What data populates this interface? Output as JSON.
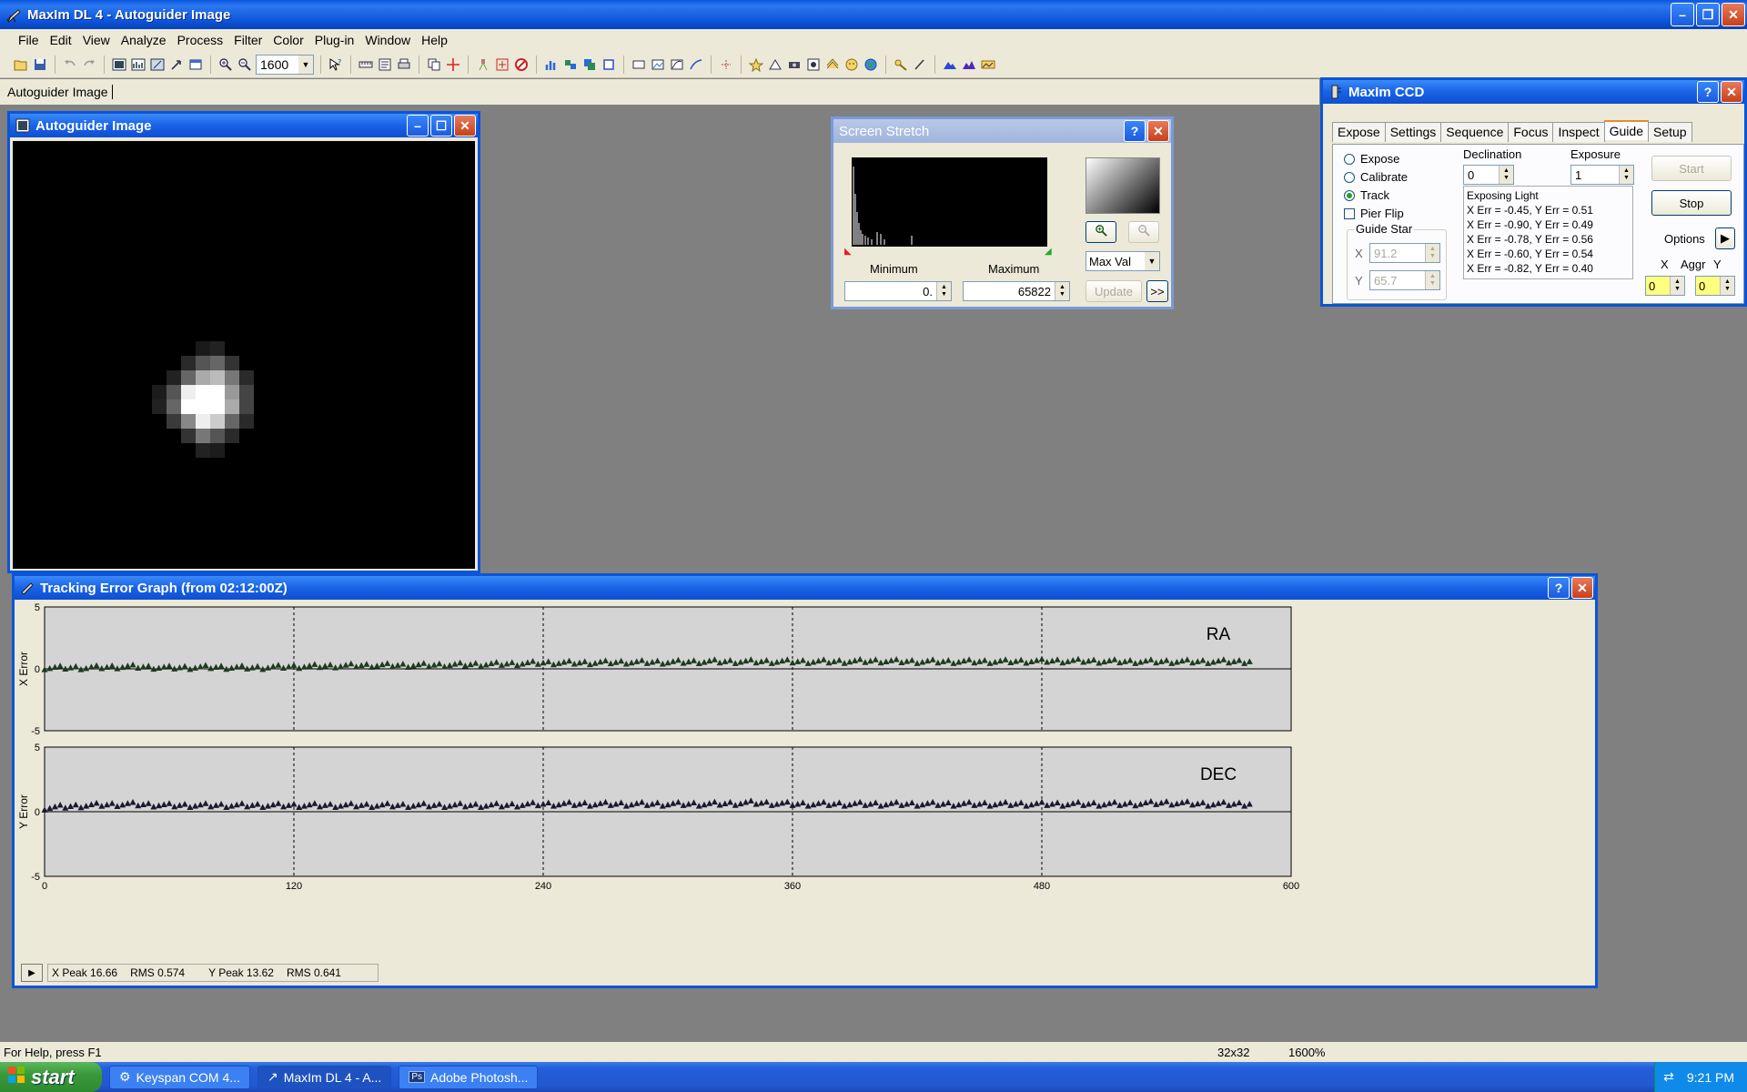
{
  "app": {
    "title": "MaxIm DL 4 - Autoguider Image"
  },
  "menu": [
    "File",
    "Edit",
    "View",
    "Analyze",
    "Process",
    "Filter",
    "Color",
    "Plug-in",
    "Window",
    "Help"
  ],
  "toolbar": {
    "zoom_value": "1600"
  },
  "doc_tab": "Autoguider Image",
  "autoguider": {
    "title": "Autoguider Image"
  },
  "stretch": {
    "title": "Screen Stretch",
    "min_label": "Minimum",
    "max_label": "Maximum",
    "min_value": "0.",
    "max_value": "65822",
    "mode": "Max Val",
    "update": "Update",
    "more": ">>"
  },
  "ccd": {
    "title": "MaxIm CCD",
    "tabs": [
      "Expose",
      "Settings",
      "Sequence",
      "Focus",
      "Inspect",
      "Guide",
      "Setup"
    ],
    "active_tab": "Guide",
    "modes": [
      "Expose",
      "Calibrate",
      "Track"
    ],
    "selected_mode": "Track",
    "pier_flip": "Pier Flip",
    "declination_label": "Declination",
    "declination_value": "0",
    "exposure_label": "Exposure",
    "exposure_value": "1",
    "guide_star_label": "Guide Star",
    "x_label": "X",
    "x_value": "91.2",
    "y_label": "Y",
    "y_value": "65.7",
    "status_lines": [
      "Exposing Light",
      "X Err = -0.45, Y Err = 0.51",
      "X Err = -0.90, Y Err = 0.49",
      "X Err = -0.78, Y Err = 0.56",
      "X Err = -0.60, Y Err = 0.54",
      "X Err = -0.82, Y Err = 0.40"
    ],
    "start": "Start",
    "stop": "Stop",
    "options": "Options",
    "aggr_x": "X",
    "aggr_label": "Aggr",
    "aggr_y": "Y",
    "aggr_x_value": "0",
    "aggr_y_value": "0"
  },
  "graph": {
    "title": "Tracking Error Graph (from 02:12:00Z)",
    "footer": {
      "xpeak": "X Peak 16.66",
      "xrms": "RMS 0.574",
      "ypeak": "Y Peak 13.62",
      "yrms": "RMS 0.641"
    }
  },
  "chart_data": [
    {
      "type": "scatter",
      "title": "RA",
      "ylabel": "X Error",
      "ylim": [
        -5,
        5
      ],
      "xlim": [
        0,
        600
      ],
      "yticks": [
        "5",
        "0",
        "-5"
      ],
      "grid": "dashed vertical every 120",
      "marker": "triangle",
      "color": "#1f3a1f",
      "x": [
        0,
        20,
        40,
        60,
        80,
        100,
        120,
        140,
        160,
        180,
        200,
        220,
        240,
        260,
        280,
        300,
        320,
        340,
        360,
        380,
        400,
        420,
        440,
        460,
        480,
        500,
        520,
        540,
        560,
        580
      ],
      "y": [
        0.1,
        0.1,
        0.2,
        0.1,
        0.15,
        0.1,
        0.2,
        0.25,
        0.3,
        0.3,
        0.35,
        0.4,
        0.5,
        0.5,
        0.55,
        0.55,
        0.6,
        0.6,
        0.6,
        0.6,
        0.65,
        0.6,
        0.6,
        0.6,
        0.65,
        0.65,
        0.6,
        0.6,
        0.6,
        0.6
      ]
    },
    {
      "type": "scatter",
      "title": "DEC",
      "ylabel": "Y Error",
      "ylim": [
        -5,
        5
      ],
      "xlim": [
        0,
        600
      ],
      "yticks": [
        "5",
        "0",
        "-5"
      ],
      "xticks": [
        "0",
        "120",
        "240",
        "360",
        "480",
        "600"
      ],
      "grid": "dashed vertical every 120",
      "marker": "triangle",
      "color": "#1a1a2e",
      "x": [
        0,
        20,
        40,
        60,
        80,
        100,
        120,
        140,
        160,
        180,
        200,
        220,
        240,
        260,
        280,
        300,
        320,
        340,
        360,
        380,
        400,
        420,
        440,
        460,
        480,
        500,
        520,
        540,
        560,
        580
      ],
      "y": [
        0.3,
        0.5,
        0.6,
        0.5,
        0.5,
        0.5,
        0.5,
        0.5,
        0.5,
        0.5,
        0.5,
        0.5,
        0.6,
        0.6,
        0.6,
        0.6,
        0.6,
        0.7,
        0.6,
        0.6,
        0.6,
        0.6,
        0.6,
        0.6,
        0.6,
        0.6,
        0.6,
        0.7,
        0.6,
        0.6
      ]
    }
  ],
  "statusbar": {
    "help": "For Help, press F1",
    "size": "32x32",
    "zoom": "1600%"
  },
  "taskbar": {
    "start": "start",
    "tasks": [
      "Keyspan COM 4...",
      "MaxIm DL 4 - A...",
      "Adobe Photosh..."
    ],
    "clock": "9:21 PM"
  }
}
